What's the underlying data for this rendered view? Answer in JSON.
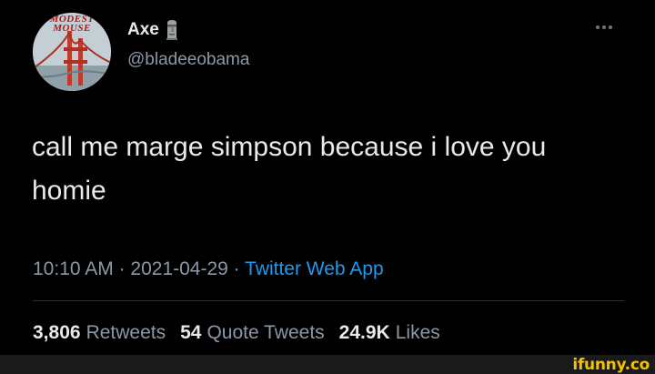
{
  "profile": {
    "avatar_band_text": "MODEST MOUSE",
    "name": "Axe",
    "name_emoji": "moai-icon",
    "handle": "@bladeeobama"
  },
  "tweet": {
    "text": "call me marge simpson because i love you homie",
    "time": "10:10 AM",
    "date": "2021-04-29",
    "separator": " · ",
    "source": "Twitter Web App"
  },
  "stats": {
    "retweets_count": "3,806",
    "retweets_label": "Retweets",
    "quote_count": "54",
    "quote_label": "Quote Tweets",
    "likes_count": "24.9K",
    "likes_label": "Likes"
  },
  "watermark": "ifunny.co",
  "colors": {
    "background": "#000000",
    "primary_text": "#e7e9ea",
    "secondary_text": "#8b98a5",
    "link": "#1d9bf0",
    "watermark": "#f3c100"
  }
}
